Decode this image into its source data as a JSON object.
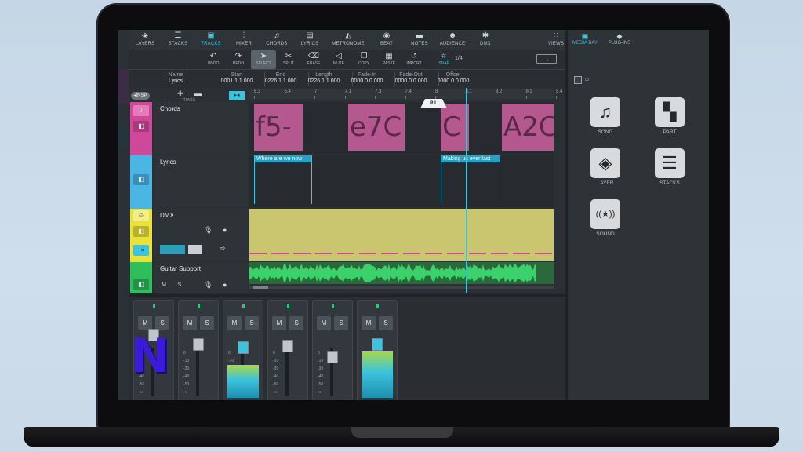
{
  "topnav": [
    {
      "label": "LAYERS",
      "icon": "layers-icon",
      "glyph": "◈",
      "active": false
    },
    {
      "label": "STACKS",
      "icon": "stacks-icon",
      "glyph": "☰",
      "active": false
    },
    {
      "label": "TRACKS",
      "icon": "tracks-icon",
      "glyph": "▣",
      "active": true
    },
    {
      "label": "MIXER",
      "icon": "mixer-icon",
      "glyph": "⫶",
      "active": false
    },
    {
      "label": "CHORDS",
      "icon": "chords-icon",
      "glyph": "♫",
      "active": false
    },
    {
      "label": "LYRICS",
      "icon": "lyrics-icon",
      "glyph": "▤",
      "active": false
    },
    {
      "label": "METRONOME",
      "icon": "metronome-icon",
      "glyph": "◭",
      "active": false
    },
    {
      "label": "BEAT",
      "icon": "beat-icon",
      "glyph": "◉",
      "active": false
    },
    {
      "label": "NOTES",
      "icon": "notes-icon",
      "glyph": "▬",
      "active": false
    },
    {
      "label": "AUDIENCE",
      "icon": "audience-icon",
      "glyph": "☻",
      "active": false
    },
    {
      "label": "DMX",
      "icon": "dmx-icon",
      "glyph": "✱",
      "active": false
    }
  ],
  "views": {
    "label": "VIEWS",
    "glyph": "⁙"
  },
  "toolbar": [
    {
      "label": "UNDO",
      "icon": "undo-icon",
      "glyph": "↶"
    },
    {
      "label": "REDO",
      "icon": "redo-icon",
      "glyph": "↷"
    },
    {
      "label": "SELECT",
      "icon": "pointer-icon",
      "glyph": "➤",
      "selected": true
    },
    {
      "label": "SPLIT",
      "icon": "split-icon",
      "glyph": "✂"
    },
    {
      "label": "ERASE",
      "icon": "eraser-icon",
      "glyph": "⌫"
    },
    {
      "label": "MUTE",
      "icon": "mute-icon",
      "glyph": "◁"
    },
    {
      "label": "COPY",
      "icon": "copy-icon",
      "glyph": "❐"
    },
    {
      "label": "PASTE",
      "icon": "paste-icon",
      "glyph": "▦"
    },
    {
      "label": "IMPORT",
      "icon": "import-icon",
      "glyph": "↺"
    },
    {
      "label": "SNAP",
      "icon": "snap-icon",
      "glyph": "#",
      "snap": true
    }
  ],
  "page_indicator": "1/4",
  "forward_glyph": "→",
  "info": {
    "name": {
      "h": "Name",
      "v": "Lyrics"
    },
    "start": {
      "h": "Start",
      "v": "0001.1.1.000"
    },
    "end": {
      "h": "End",
      "v": "0226.1.1.000"
    },
    "length": {
      "h": "Length",
      "v": "0226.1.1.000"
    },
    "fadein": {
      "h": "Fade-In",
      "v": "0000.0.0.000"
    },
    "fadeout": {
      "h": "Fade-Out",
      "v": "0000.0.0.000"
    },
    "offset": {
      "h": "Offset",
      "v": "0000.0.0.000"
    }
  },
  "arrange": {
    "insp_label": "◂INSP",
    "track_label": "TRACK",
    "add": "✚",
    "del": "▬",
    "link_glyph": "▸◂",
    "ruler": [
      "6.3",
      "6.4",
      "7",
      "7.1",
      "7.3",
      "7.4",
      "8",
      "8.1",
      "8.2",
      "8.3",
      "8.4"
    ],
    "rl": "R L",
    "tracks": {
      "chords": {
        "name": "Chords",
        "clips": [
          "f5-",
          "e7C",
          "C",
          "A2C"
        ]
      },
      "lyrics": {
        "name": "Lyrics",
        "clips": [
          "Where are we now",
          "Making us ever last"
        ]
      },
      "dmx": {
        "name": "DMX"
      },
      "guitar": {
        "name": "Guitar Support",
        "m": "M",
        "s": "S"
      }
    }
  },
  "mixer": {
    "scale": [
      "0",
      "-10",
      "-30",
      "-40",
      "-50",
      "-∞"
    ],
    "channels": [
      {
        "m": "M",
        "s": "S"
      },
      {
        "m": "M",
        "s": "S"
      },
      {
        "m": "M",
        "s": "S"
      },
      {
        "m": "M",
        "s": "S"
      },
      {
        "m": "M",
        "s": "S"
      },
      {
        "m": "M",
        "s": "S"
      }
    ],
    "logo": "N"
  },
  "rpanel": {
    "tabs": [
      {
        "label": "MEDIA BAY",
        "glyph": "▣",
        "active": true
      },
      {
        "label": "PLUG-INS",
        "glyph": "◆",
        "active": false
      }
    ],
    "home": "⌂",
    "items": [
      {
        "label": "SONG",
        "glyph": "♫"
      },
      {
        "label": "PART",
        "glyph": "▚"
      },
      {
        "label": "LAYER",
        "glyph": "◈"
      },
      {
        "label": "STACKS",
        "glyph": "☰"
      },
      {
        "label": "SOUND",
        "glyph": "((★))"
      }
    ]
  },
  "colors": {
    "accent": "#3cc3de",
    "chords": "#d0489a",
    "lyrics": "#4ab6e4",
    "dmx": "#e9e23a",
    "guitar": "#2fbf5a"
  }
}
